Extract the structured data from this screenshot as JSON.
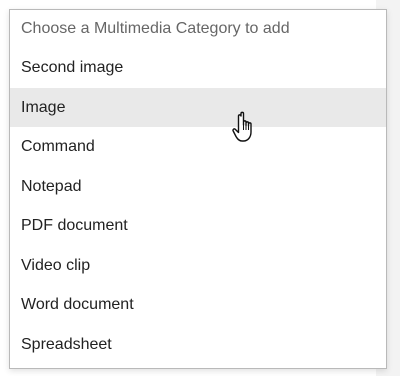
{
  "dropdown": {
    "placeholder": "Choose a Multimedia Category to add",
    "options": [
      "Second image",
      "Image",
      "Command",
      "Notepad",
      "PDF document",
      "Video clip",
      "Word document",
      "Spreadsheet"
    ],
    "hovered_option": "Image"
  },
  "cursor": {
    "icon": "hand-pointer-icon"
  },
  "colors": {
    "hover_background": "#e9e9e9",
    "border": "#b9b9b9",
    "text": "#222222",
    "placeholder_text": "#666666"
  }
}
